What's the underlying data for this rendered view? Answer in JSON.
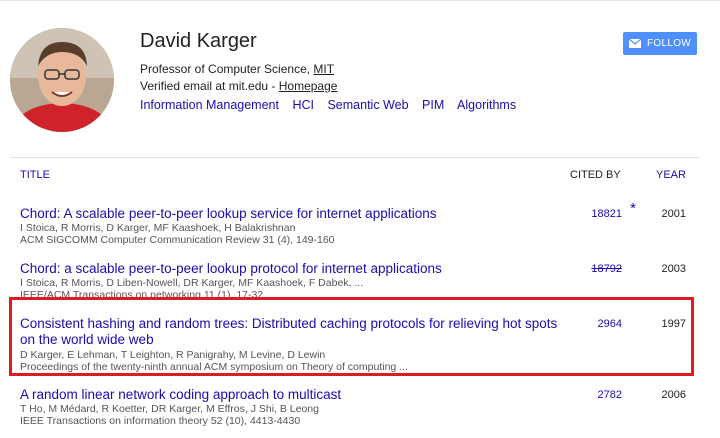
{
  "profile": {
    "name": "David Karger",
    "affiliation_prefix": "Professor of Computer Science, ",
    "affiliation_link": "MIT",
    "email_prefix": "Verified email at mit.edu - ",
    "homepage_link": "Homepage",
    "interests": [
      "Information Management",
      "HCI",
      "Semantic Web",
      "PIM",
      "Algorithms"
    ]
  },
  "follow": {
    "label": "FOLLOW"
  },
  "table": {
    "headers": {
      "title": "TITLE",
      "cited_by": "CITED BY",
      "year": "YEAR"
    },
    "rows": [
      {
        "title": "Chord: A scalable peer-to-peer lookup service for internet applications",
        "authors": "I Stoica, R Morris, D Karger, MF Kaashoek, H Balakrishnan",
        "venue": "ACM SIGCOMM Computer Communication Review 31 (4), 149-160",
        "cited": "18821",
        "star": "*",
        "year": "2001"
      },
      {
        "title": "Chord: a scalable peer-to-peer lookup protocol for internet applications",
        "authors": "I Stoica, R Morris, D Liben-Nowell, DR Karger, MF Kaashoek, F Dabek, ...",
        "venue": "IEEE/ACM Transactions on networking 11 (1), 17-32",
        "cited": "18792",
        "year": "2003"
      },
      {
        "title": "Consistent hashing and random trees: Distributed caching protocols for relieving hot spots on the world wide web",
        "authors": "D Karger, E Lehman, T Leighton, R Panigrahy, M Levine, D Lewin",
        "venue": "Proceedings of the twenty-ninth annual ACM symposium on Theory of computing ...",
        "cited": "2964",
        "year": "1997"
      },
      {
        "title": "A random linear network coding approach to multicast",
        "authors": "T Ho, M Médard, R Koetter, DR Karger, M Effros, J Shi, B Leong",
        "venue": "IEEE Transactions on information theory 52 (10), 4413-4430",
        "cited": "2782",
        "year": "2006"
      }
    ]
  },
  "colors": {
    "link": "#1a0dab",
    "button": "#4d90fe",
    "highlight": "#e01a24"
  }
}
